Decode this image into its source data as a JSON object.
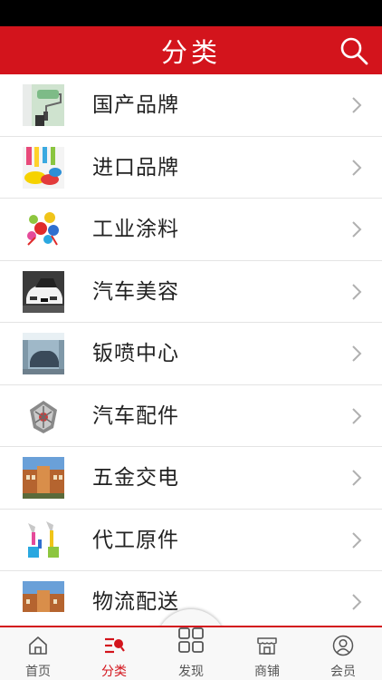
{
  "header": {
    "title": "分类"
  },
  "categories": [
    {
      "label": "国产品牌",
      "icon": "paint-roller-image"
    },
    {
      "label": "进口品牌",
      "icon": "paint-splash-image"
    },
    {
      "label": "工业涂料",
      "icon": "color-splash-image"
    },
    {
      "label": "汽车美容",
      "icon": "white-car-image"
    },
    {
      "label": "钣喷中心",
      "icon": "spray-booth-image"
    },
    {
      "label": "汽车配件",
      "icon": "wheel-rim-image"
    },
    {
      "label": "五金交电",
      "icon": "building-image"
    },
    {
      "label": "代工原件",
      "icon": "paint-cans-image"
    },
    {
      "label": "物流配送",
      "icon": "building-image"
    }
  ],
  "tabbar": {
    "items": [
      {
        "label": "首页",
        "icon": "home-icon"
      },
      {
        "label": "分类",
        "icon": "category-icon"
      },
      {
        "label": "发现",
        "icon": "grid-icon"
      },
      {
        "label": "商铺",
        "icon": "shop-icon"
      },
      {
        "label": "会员",
        "icon": "user-icon"
      }
    ]
  },
  "colors": {
    "accent": "#d3141c",
    "active": "#d3141c",
    "inactive": "#555555"
  }
}
